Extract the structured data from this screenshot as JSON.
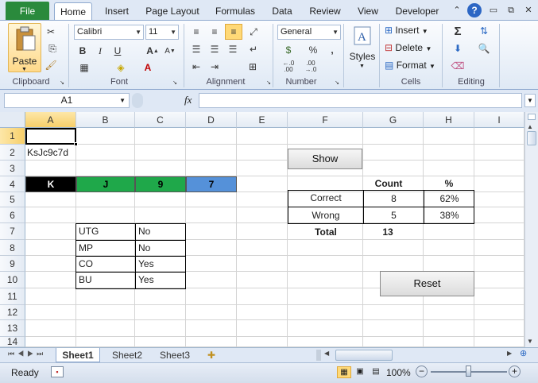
{
  "tabs": {
    "file": "File",
    "home": "Home",
    "insert": "Insert",
    "page_layout": "Page Layout",
    "formulas": "Formulas",
    "data": "Data",
    "review": "Review",
    "view": "View",
    "developer": "Developer"
  },
  "ribbon": {
    "clipboard": {
      "paste": "Paste",
      "label": "Clipboard"
    },
    "font": {
      "name": "Calibri",
      "size": "11",
      "label": "Font",
      "bold": "B",
      "italic": "I",
      "underline": "U"
    },
    "alignment": {
      "label": "Alignment"
    },
    "number": {
      "format": "General",
      "percent": "%",
      "comma": ",",
      "label": "Number",
      "dec_up": "←.0 .00",
      "dec_down": ".00 →.0"
    },
    "styles": {
      "label": "Styles"
    },
    "cells": {
      "insert": "Insert",
      "delete": "Delete",
      "format": "Format",
      "label": "Cells"
    },
    "editing": {
      "label": "Editing"
    }
  },
  "formula_bar": {
    "name_box": "A1",
    "fx": "fx",
    "value": ""
  },
  "columns": [
    "A",
    "B",
    "C",
    "D",
    "E",
    "F",
    "G",
    "H",
    "I"
  ],
  "rows": [
    "1",
    "2",
    "3",
    "4",
    "5",
    "6",
    "7",
    "8",
    "9",
    "10",
    "11",
    "12",
    "13",
    "14"
  ],
  "cells": {
    "a2": "KsJc9c7d",
    "cards": [
      {
        "text": "K",
        "bg": "#000000",
        "fg": "#ffffff"
      },
      {
        "text": "J",
        "bg": "#1fa84a",
        "fg": "#000000"
      },
      {
        "text": "9",
        "bg": "#1fa84a",
        "fg": "#000000"
      },
      {
        "text": "7",
        "bg": "#5591d9",
        "fg": "#000000"
      }
    ],
    "positions": [
      {
        "pos": "UTG",
        "val": "No"
      },
      {
        "pos": "MP",
        "val": "No"
      },
      {
        "pos": "CO",
        "val": "Yes"
      },
      {
        "pos": "BU",
        "val": "Yes"
      }
    ],
    "stats": {
      "count_hdr": "Count",
      "pct_hdr": "%",
      "correct_label": "Correct",
      "correct_count": "8",
      "correct_pct": "62%",
      "wrong_label": "Wrong",
      "wrong_count": "5",
      "wrong_pct": "38%",
      "total_label": "Total",
      "total_count": "13"
    }
  },
  "buttons": {
    "show": "Show",
    "reset": "Reset"
  },
  "sheets": [
    "Sheet1",
    "Sheet2",
    "Sheet3"
  ],
  "status": {
    "ready": "Ready",
    "zoom": "100%"
  }
}
